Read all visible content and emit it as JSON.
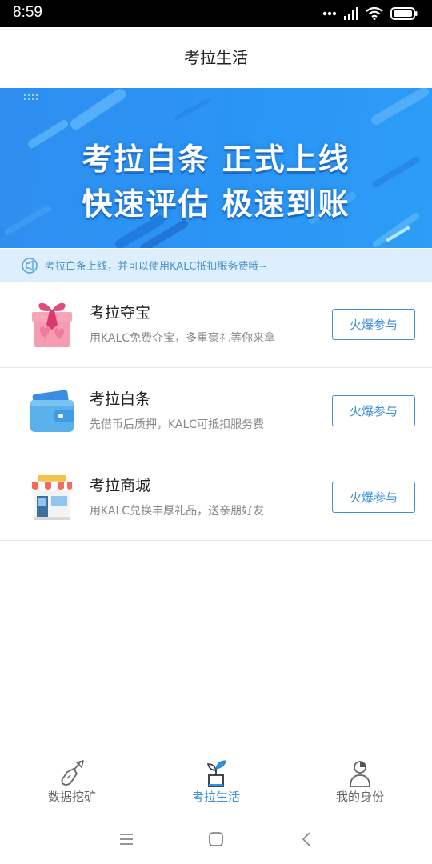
{
  "status_bar": {
    "time": "8:59"
  },
  "header": {
    "title": "考拉生活"
  },
  "banner": {
    "line1": "考拉白条  正式上线",
    "line2": "快速评估  极速到账"
  },
  "notice": {
    "text": "考拉白条上线，并可以使用KALC抵扣服务费哦~"
  },
  "items": [
    {
      "title": "考拉夺宝",
      "desc": "用KALC免费夺宝，多重豪礼等你来拿",
      "button": "火爆参与",
      "icon": "gift-box-icon"
    },
    {
      "title": "考拉白条",
      "desc": "先借币后质押，KALC可抵扣服务费",
      "button": "火爆参与",
      "icon": "wallet-icon"
    },
    {
      "title": "考拉商城",
      "desc": "用KALC兑换丰厚礼品，送亲朋好友",
      "button": "火爆参与",
      "icon": "shop-icon"
    }
  ],
  "bottom_nav": [
    {
      "label": "数据挖矿",
      "icon": "shovel-icon"
    },
    {
      "label": "考拉生活",
      "icon": "sprout-icon",
      "active": true
    },
    {
      "label": "我的身份",
      "icon": "user-icon"
    }
  ],
  "colors": {
    "accent": "#3d8fd8",
    "banner": "#2d92f2",
    "notice_bg": "#ddeffc"
  }
}
